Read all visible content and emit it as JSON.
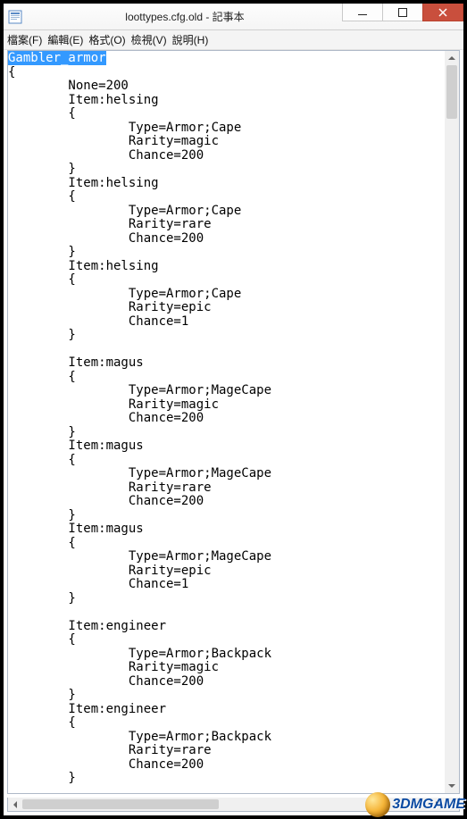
{
  "window": {
    "title": "loottypes.cfg.old - 記事本"
  },
  "menu": {
    "file": "檔案(F)",
    "edit": "編輯(E)",
    "format": "格式(O)",
    "view": "檢視(V)",
    "help": "說明(H)"
  },
  "editor": {
    "selected_text": "Gambler_armor",
    "lines": [
      "{",
      "        None=200",
      "        Item:helsing",
      "        {",
      "                Type=Armor;Cape",
      "                Rarity=magic",
      "                Chance=200",
      "        }",
      "        Item:helsing",
      "        {",
      "                Type=Armor;Cape",
      "                Rarity=rare",
      "                Chance=200",
      "        }",
      "        Item:helsing",
      "        {",
      "                Type=Armor;Cape",
      "                Rarity=epic",
      "                Chance=1",
      "        }",
      "",
      "        Item:magus",
      "        {",
      "                Type=Armor;MageCape",
      "                Rarity=magic",
      "                Chance=200",
      "        }",
      "        Item:magus",
      "        {",
      "                Type=Armor;MageCape",
      "                Rarity=rare",
      "                Chance=200",
      "        }",
      "        Item:magus",
      "        {",
      "                Type=Armor;MageCape",
      "                Rarity=epic",
      "                Chance=1",
      "        }",
      "",
      "        Item:engineer",
      "        {",
      "                Type=Armor;Backpack",
      "                Rarity=magic",
      "                Chance=200",
      "        }",
      "        Item:engineer",
      "        {",
      "                Type=Armor;Backpack",
      "                Rarity=rare",
      "                Chance=200",
      "        }"
    ]
  },
  "watermark": {
    "text": "3DMGAME"
  }
}
